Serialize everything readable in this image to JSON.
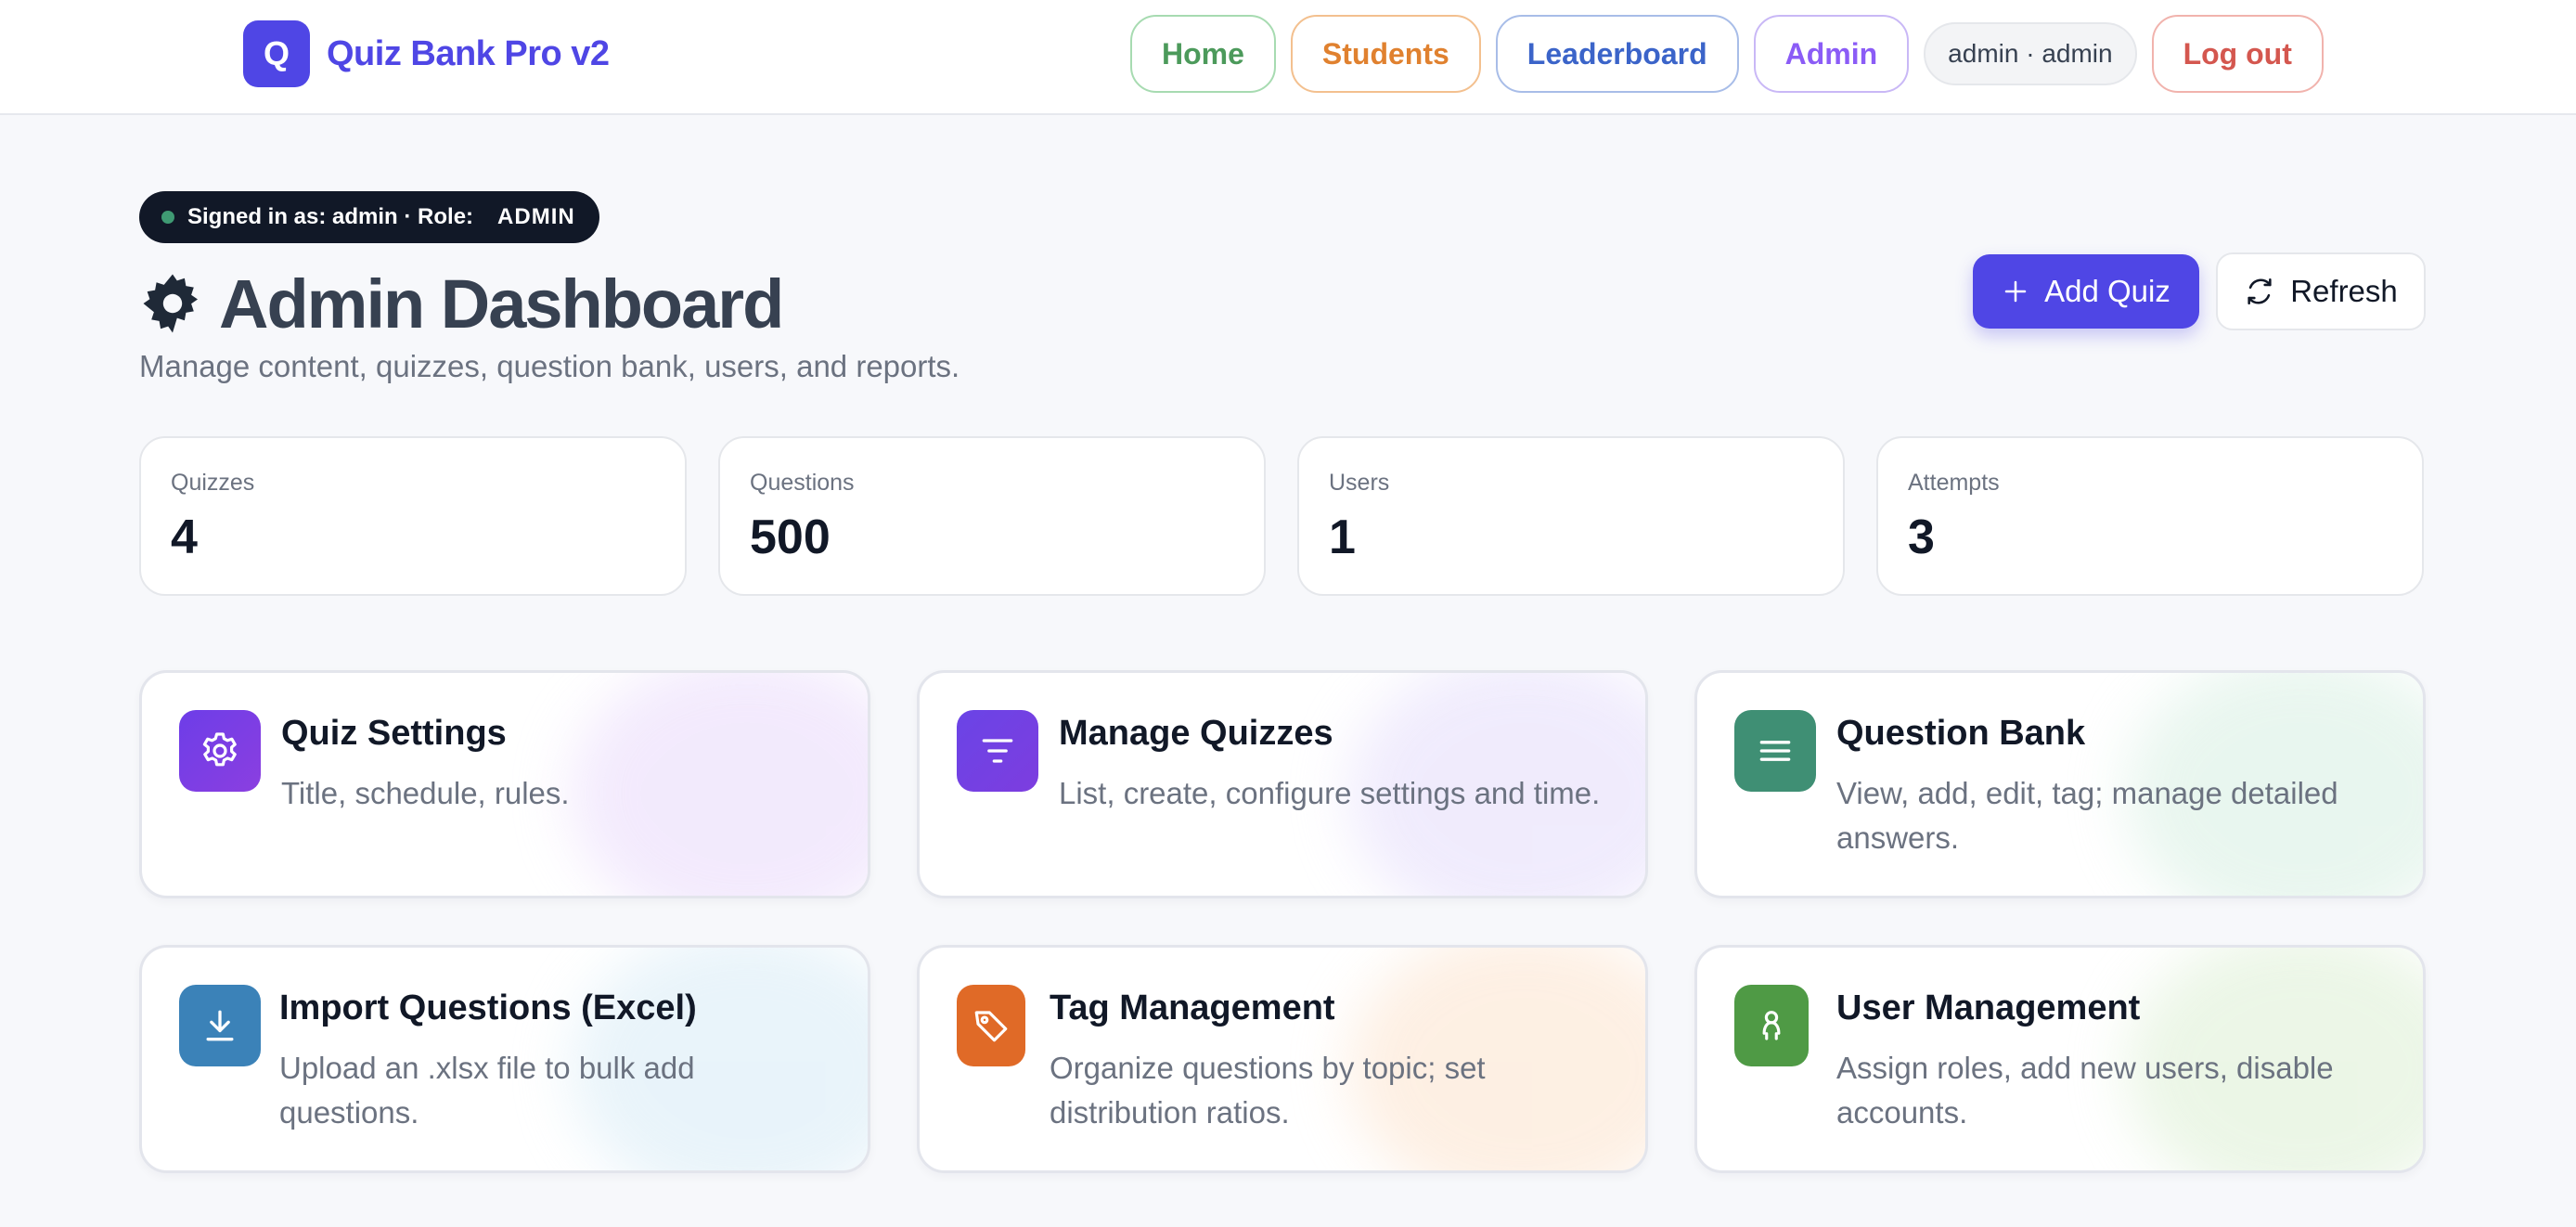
{
  "brand": {
    "badge": "Q",
    "name": "Quiz Bank Pro v2"
  },
  "nav": {
    "home": "Home",
    "students": "Students",
    "leaderboard": "Leaderboard",
    "admin": "Admin",
    "user": "admin · admin",
    "logout": "Log out"
  },
  "header": {
    "signed_in": "Signed in as: admin · Role:",
    "role": "ADMIN",
    "title": "Admin Dashboard",
    "subtitle": "Manage content, quizzes, question bank, users, and reports.",
    "add_label": "Add Quiz",
    "refresh_label": "Refresh"
  },
  "stats": [
    {
      "label": "Quizzes",
      "value": "4"
    },
    {
      "label": "Questions",
      "value": "500"
    },
    {
      "label": "Users",
      "value": "1"
    },
    {
      "label": "Attempts",
      "value": "3"
    }
  ],
  "cards": [
    {
      "title": "Quiz Settings",
      "desc": "Title, schedule, rules.",
      "icon": "gear-icon"
    },
    {
      "title": "Manage Quizzes",
      "desc": "List, create, configure settings and time.",
      "icon": "list-filter-icon"
    },
    {
      "title": "Question Bank",
      "desc": "View, add, edit, tag; manage detailed answers.",
      "icon": "menu-lines-icon"
    },
    {
      "title": "Import Questions (Excel)",
      "desc": "Upload an .xlsx file to bulk add questions.",
      "icon": "download-icon"
    },
    {
      "title": "Tag Management",
      "desc": "Organize questions by topic; set distribution ratios.",
      "icon": "tag-icon"
    },
    {
      "title": "User Management",
      "desc": "Assign roles, add new users, disable accounts.",
      "icon": "user-icon"
    }
  ],
  "colors": {
    "accent": "#4f46e5",
    "home": "#4c9a5b",
    "students": "#e0812f",
    "leaderboard": "#3b64c9",
    "admin": "#8b5cf6",
    "logout": "#d4574f"
  }
}
